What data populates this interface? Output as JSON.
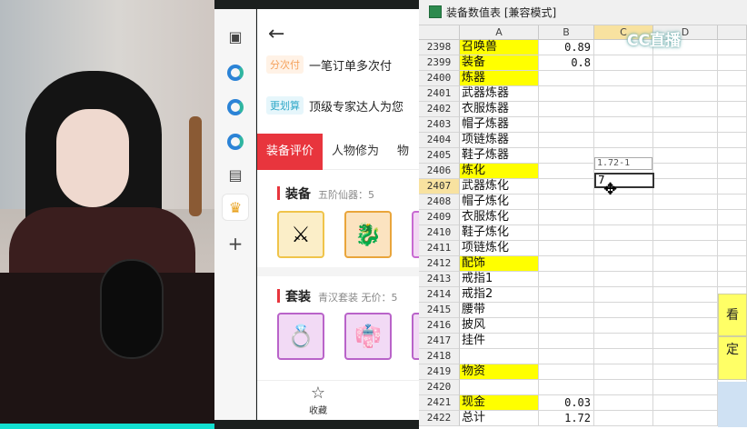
{
  "rail": {
    "icons": [
      "sidebar-toggle-icon",
      "edge-icon",
      "edge-icon",
      "edge-icon",
      "collection-icon",
      "shopping-icon",
      "plus-icon"
    ]
  },
  "shop": {
    "back_glyph": "←",
    "promos": [
      {
        "tag": "分次付",
        "text": "一笔订单多次付",
        "tag_color": "#f5a25d",
        "tag_bg": "#fff2e6"
      },
      {
        "tag": "更划算",
        "text": "顶级专家达人为您",
        "tag_color": "#32a9c9",
        "tag_bg": "#e6f6fb"
      }
    ],
    "tabs": [
      "装备评价",
      "人物修为",
      "物"
    ],
    "sections": [
      {
        "title": "装备",
        "subtitle": "五阶仙器：5"
      },
      {
        "title": "套装",
        "subtitle": "青汉套装   无价：5"
      }
    ],
    "footer": {
      "favorite_label": "收藏"
    }
  },
  "sheet": {
    "title": "装备数值表  [兼容模式]",
    "watermark": "CC直播",
    "columns": [
      "A",
      "B",
      "C",
      "D"
    ],
    "rows": [
      {
        "num": "2398",
        "a": "召唤兽",
        "b": "0.89",
        "yellow": true
      },
      {
        "num": "2399",
        "a": "装备",
        "b": "0.8",
        "yellow": true
      },
      {
        "num": "2400",
        "a": "炼器",
        "b": "",
        "yellow": true
      },
      {
        "num": "2401",
        "a": "武器炼器",
        "b": "",
        "yellow": false
      },
      {
        "num": "2402",
        "a": "衣服炼器",
        "b": "",
        "yellow": false
      },
      {
        "num": "2403",
        "a": "帽子炼器",
        "b": "",
        "yellow": false
      },
      {
        "num": "2404",
        "a": "项链炼器",
        "b": "",
        "yellow": false
      },
      {
        "num": "2405",
        "a": "鞋子炼器",
        "b": "",
        "yellow": false
      },
      {
        "num": "2406",
        "a": "炼化",
        "b": "",
        "yellow": true
      },
      {
        "num": "2407",
        "a": "武器炼化",
        "b": "",
        "yellow": false,
        "selected": true
      },
      {
        "num": "2408",
        "a": "帽子炼化",
        "b": "",
        "yellow": false
      },
      {
        "num": "2409",
        "a": "衣服炼化",
        "b": "",
        "yellow": false
      },
      {
        "num": "2410",
        "a": "鞋子炼化",
        "b": "",
        "yellow": false
      },
      {
        "num": "2411",
        "a": "项链炼化",
        "b": "",
        "yellow": false
      },
      {
        "num": "2412",
        "a": "配饰",
        "b": "",
        "yellow": true
      },
      {
        "num": "2413",
        "a": "戒指1",
        "b": "",
        "yellow": false
      },
      {
        "num": "2414",
        "a": "戒指2",
        "b": "",
        "yellow": false
      },
      {
        "num": "2415",
        "a": "腰带",
        "b": "",
        "yellow": false
      },
      {
        "num": "2416",
        "a": "披风",
        "b": "",
        "yellow": false
      },
      {
        "num": "2417",
        "a": "挂件",
        "b": "",
        "yellow": false
      },
      {
        "num": "2418",
        "a": "",
        "b": "",
        "yellow": false
      },
      {
        "num": "2419",
        "a": "物资",
        "b": "",
        "yellow": true
      },
      {
        "num": "2420",
        "a": "",
        "b": "",
        "yellow": false
      },
      {
        "num": "2421",
        "a": "现金",
        "b": "0.03",
        "yellow": true
      },
      {
        "num": "2422",
        "a": "总计",
        "b": "1.72",
        "yellow": false
      }
    ],
    "formula_tip": "1.72-1",
    "active_cell_value": "7",
    "side_notes": [
      "看",
      "定"
    ]
  }
}
